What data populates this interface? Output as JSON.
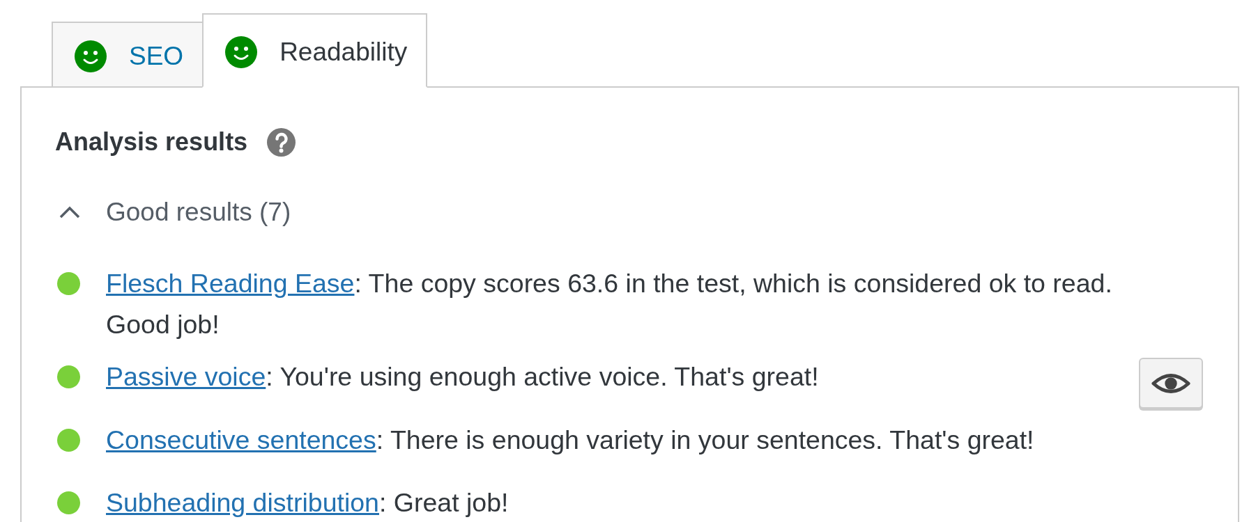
{
  "tabs": [
    {
      "label": "SEO",
      "color": "#008a00",
      "selected": false
    },
    {
      "label": "Readability",
      "color": "#008a00",
      "selected": true
    }
  ],
  "panel": {
    "heading": "Analysis results",
    "result_groups": [
      {
        "title": "Good results (7)",
        "expanded": true,
        "items": [
          {
            "color": "#7ad03a",
            "link": "Flesch Reading Ease",
            "text": ": The copy scores 63.6 in the test, which is considered ok to read. Good job!",
            "marker_button": false
          },
          {
            "color": "#7ad03a",
            "link": "Passive voice",
            "text": ": You're using enough active voice. That's great!",
            "marker_button": true
          },
          {
            "color": "#7ad03a",
            "link": "Consecutive sentences",
            "text": ": There is enough variety in your sentences. That's great!",
            "marker_button": false
          },
          {
            "color": "#7ad03a",
            "link": "Subheading distribution",
            "text": ": Great job!",
            "marker_button": false
          }
        ]
      }
    ]
  }
}
